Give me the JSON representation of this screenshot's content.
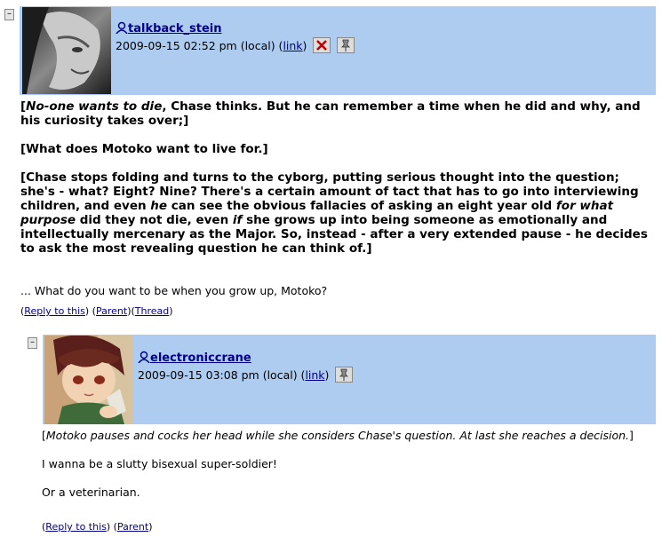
{
  "comment1": {
    "collapse": "–",
    "username": "talkback_stein",
    "date": "2009-09-15 02:52 pm (local)",
    "link_label": "link",
    "paragraphs": [
      {
        "italic_lead": "No-one wants to die",
        "rest": ", Chase thinks. But he can remember a time when he did and why, and his curiosity takes over;]"
      },
      {
        "text": "[What does Motoko want to live for.]"
      },
      {
        "part1": "[Chase stops folding and turns to the cyborg, putting serious thought into the question; she's - what? Eight? Nine? There's a certain amount of tact that has to go into interviewing children, and even ",
        "em1": "he",
        "part2": " can see the obvious fallacies of asking an eight year old ",
        "em2": "for what purpose",
        "part3": " did they not die, even ",
        "em3": "if",
        "part4": " she grows up into being someone as emotionally and intellectually mercenary as the Major. So, instead - after a very extended pause - he decides to ask the most revealing question he can think of.]"
      }
    ],
    "quote": "... What do you want to be when you grow up, Motoko?",
    "reply_label": "Reply to this",
    "parent_label": "Parent",
    "thread_label": "Thread"
  },
  "comment2": {
    "collapse": "–",
    "username": "electroniccrane",
    "date": "2009-09-15 03:08 pm (local)",
    "link_label": "link",
    "para1": "Motoko pauses and cocks her head while she considers Chase's question. At last she reaches a decision.",
    "para2": "I wanna be a slutty bisexual super-soldier!",
    "para3": "Or a veterinarian.",
    "reply_label": "Reply to this",
    "parent_label": "Parent"
  },
  "colors": {
    "header_bg": "#aeccf0",
    "link": "#00008b"
  }
}
